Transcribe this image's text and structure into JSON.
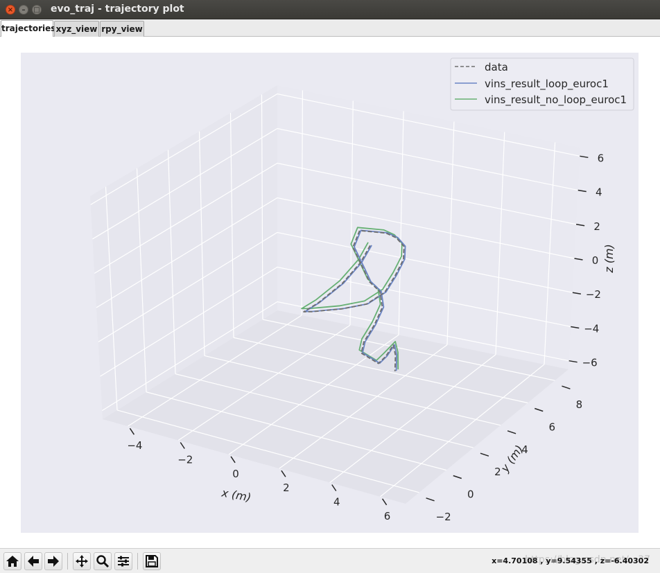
{
  "window": {
    "title": "evo_traj - trajectory plot",
    "close_glyph": "×",
    "min_glyph": "–",
    "max_glyph": "□"
  },
  "tabs": [
    {
      "label": "trajectories",
      "active": true
    },
    {
      "label": "xyz_view",
      "active": false
    },
    {
      "label": "rpy_view",
      "active": false
    }
  ],
  "toolbar": {
    "buttons": [
      {
        "name": "home",
        "icon": "home-icon"
      },
      {
        "name": "back",
        "icon": "arrow-left-icon"
      },
      {
        "name": "forward",
        "icon": "arrow-right-icon"
      },
      {
        "name": "pan",
        "icon": "move-icon"
      },
      {
        "name": "zoom",
        "icon": "magnifier-icon"
      },
      {
        "name": "configure-subplots",
        "icon": "sliders-icon"
      },
      {
        "name": "save",
        "icon": "floppy-disk-icon"
      }
    ],
    "coordinate_readout": "x=4.70108 , y=9.54355 , z=-6.40302",
    "watermark": "https://blog.csdn.net/...37"
  },
  "colors": {
    "axes_bg": "#eaeaf2",
    "pane_left": "#e6e6ee",
    "pane_floor": "#e2e2ea",
    "pane_back": "#e9e9f1",
    "grid": "#ffffff",
    "data": "#6e6e6e",
    "loop": "#6a84c4",
    "no_loop": "#66b073"
  },
  "chart_data": {
    "type": "line",
    "projection": "3d",
    "title": "",
    "xlabel": "x (m)",
    "ylabel": "y (m)",
    "zlabel": "z (m)",
    "xlim": [
      -5,
      7
    ],
    "ylim": [
      -3,
      9
    ],
    "zlim": [
      -6.5,
      6.5
    ],
    "xticks": [
      "−4",
      "−2",
      "0",
      "2",
      "4",
      "6"
    ],
    "yticks": [
      "−2",
      "0",
      "2",
      "4",
      "6",
      "8"
    ],
    "zticks": [
      "−6",
      "−4",
      "−2",
      "0",
      "2",
      "4",
      "6"
    ],
    "legend": {
      "placement": "top-right",
      "entries": [
        {
          "label": "data",
          "style": "dashed",
          "color": "#6e6e6e"
        },
        {
          "label": "vins_result_loop_euroc1",
          "style": "solid",
          "color": "#6a84c4"
        },
        {
          "label": "vins_result_no_loop_euroc1",
          "style": "solid",
          "color": "#66b073"
        }
      ]
    },
    "series": [
      {
        "name": "data",
        "style": "dashed",
        "points_xyz": [
          [
            1.9,
            3.6,
            2.7
          ],
          [
            1.7,
            3.3,
            1.8
          ],
          [
            1.2,
            2.9,
            0.6
          ],
          [
            0.6,
            2.3,
            -0.4
          ],
          [
            0.2,
            2.0,
            -0.9
          ],
          [
            0.3,
            2.4,
            -1.1
          ],
          [
            1.2,
            2.9,
            -0.9
          ],
          [
            2.0,
            3.2,
            -0.5
          ],
          [
            2.6,
            3.4,
            0.3
          ],
          [
            2.9,
            3.6,
            1.3
          ],
          [
            3.1,
            3.8,
            2.2
          ],
          [
            3.0,
            4.0,
            2.8
          ],
          [
            2.7,
            4.0,
            3.2
          ],
          [
            2.4,
            3.8,
            3.5
          ],
          [
            1.6,
            3.4,
            3.6
          ],
          [
            1.4,
            3.3,
            2.6
          ],
          [
            1.8,
            3.3,
            1.5
          ],
          [
            2.0,
            3.4,
            0.7
          ],
          [
            2.3,
            3.6,
            0.1
          ],
          [
            2.4,
            3.6,
            -0.8
          ],
          [
            2.2,
            3.4,
            -1.8
          ],
          [
            1.9,
            3.2,
            -2.8
          ],
          [
            1.8,
            3.2,
            -3.5
          ],
          [
            2.6,
            3.0,
            -3.7
          ],
          [
            3.0,
            2.8,
            -3.0
          ],
          [
            3.3,
            2.8,
            -2.2
          ],
          [
            3.5,
            2.6,
            -2.6
          ],
          [
            3.6,
            2.4,
            -3.4
          ]
        ]
      },
      {
        "name": "vins_result_loop_euroc1",
        "style": "solid",
        "points_xyz": [
          [
            1.95,
            3.62,
            2.72
          ],
          [
            1.74,
            3.31,
            1.82
          ],
          [
            1.24,
            2.92,
            0.62
          ],
          [
            0.64,
            2.32,
            -0.38
          ],
          [
            0.24,
            2.02,
            -0.88
          ],
          [
            0.34,
            2.42,
            -1.08
          ],
          [
            1.24,
            2.92,
            -0.88
          ],
          [
            2.04,
            3.22,
            -0.48
          ],
          [
            2.64,
            3.42,
            0.32
          ],
          [
            2.94,
            3.62,
            1.32
          ],
          [
            3.14,
            3.82,
            2.22
          ],
          [
            3.04,
            4.02,
            2.82
          ],
          [
            2.74,
            4.02,
            3.22
          ],
          [
            2.44,
            3.82,
            3.52
          ],
          [
            1.64,
            3.42,
            3.62
          ],
          [
            1.44,
            3.32,
            2.62
          ],
          [
            1.84,
            3.32,
            1.52
          ],
          [
            2.04,
            3.42,
            0.72
          ],
          [
            2.34,
            3.62,
            0.12
          ],
          [
            2.44,
            3.62,
            -0.78
          ],
          [
            2.24,
            3.42,
            -1.78
          ],
          [
            1.94,
            3.22,
            -2.78
          ],
          [
            1.84,
            3.22,
            -3.48
          ],
          [
            2.64,
            3.02,
            -3.68
          ],
          [
            3.04,
            2.82,
            -2.98
          ],
          [
            3.34,
            2.82,
            -2.18
          ],
          [
            3.54,
            2.62,
            -2.58
          ],
          [
            3.64,
            2.42,
            -3.38
          ]
        ]
      },
      {
        "name": "vins_result_no_loop_euroc1",
        "style": "solid",
        "points_xyz": [
          [
            1.85,
            3.55,
            2.9
          ],
          [
            1.65,
            3.25,
            2.0
          ],
          [
            1.15,
            2.85,
            0.8
          ],
          [
            0.55,
            2.25,
            -0.2
          ],
          [
            0.15,
            1.95,
            -0.7
          ],
          [
            0.25,
            2.35,
            -0.9
          ],
          [
            1.15,
            2.85,
            -0.7
          ],
          [
            1.95,
            3.15,
            -0.3
          ],
          [
            2.55,
            3.35,
            0.5
          ],
          [
            2.85,
            3.55,
            1.5
          ],
          [
            3.05,
            3.75,
            2.4
          ],
          [
            2.95,
            3.95,
            3.0
          ],
          [
            2.65,
            3.95,
            3.4
          ],
          [
            2.35,
            3.75,
            3.7
          ],
          [
            1.55,
            3.35,
            3.8
          ],
          [
            1.35,
            3.25,
            2.8
          ],
          [
            1.75,
            3.25,
            1.7
          ],
          [
            1.95,
            3.35,
            0.9
          ],
          [
            2.25,
            3.55,
            0.3
          ],
          [
            2.35,
            3.55,
            -0.6
          ],
          [
            2.15,
            3.35,
            -1.6
          ],
          [
            1.85,
            3.15,
            -2.6
          ],
          [
            1.75,
            3.15,
            -3.3
          ],
          [
            2.55,
            2.95,
            -3.5
          ],
          [
            2.95,
            2.75,
            -2.8
          ],
          [
            3.35,
            2.85,
            -2.0
          ],
          [
            3.6,
            2.6,
            -2.4
          ],
          [
            3.75,
            2.35,
            -3.2
          ]
        ]
      }
    ]
  }
}
